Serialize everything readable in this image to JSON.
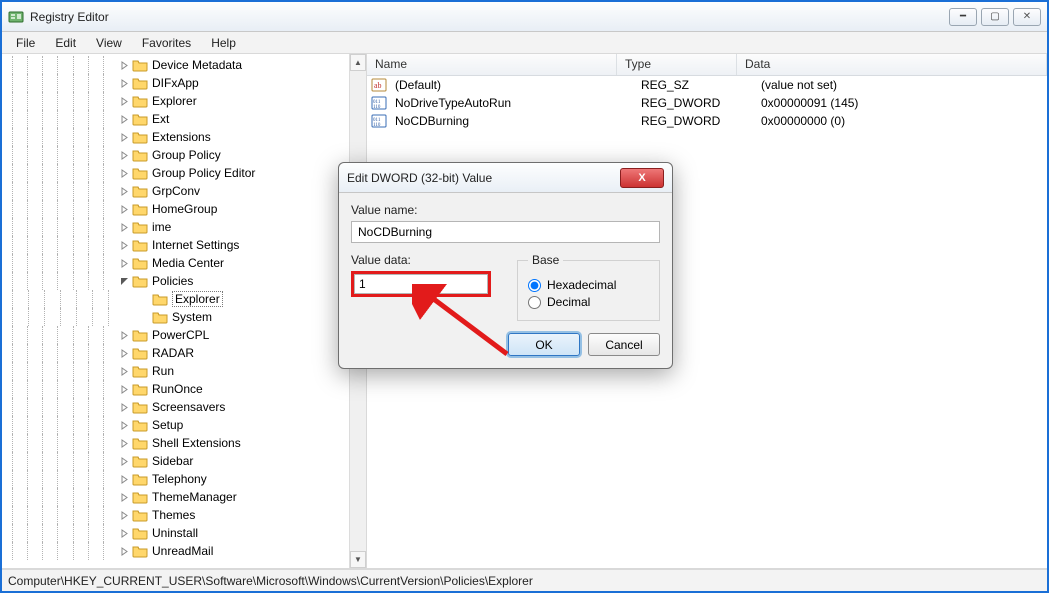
{
  "window": {
    "title": "Registry Editor"
  },
  "menu": {
    "items": [
      "File",
      "Edit",
      "View",
      "Favorites",
      "Help"
    ]
  },
  "tree": {
    "items": [
      {
        "label": "Device Metadata",
        "expandable": true,
        "indent": 0
      },
      {
        "label": "DIFxApp",
        "expandable": true,
        "indent": 0
      },
      {
        "label": "Explorer",
        "expandable": true,
        "indent": 0
      },
      {
        "label": "Ext",
        "expandable": true,
        "indent": 0
      },
      {
        "label": "Extensions",
        "expandable": true,
        "indent": 0
      },
      {
        "label": "Group Policy",
        "expandable": true,
        "indent": 0
      },
      {
        "label": "Group Policy Editor",
        "expandable": true,
        "indent": 0
      },
      {
        "label": "GrpConv",
        "expandable": true,
        "indent": 0
      },
      {
        "label": "HomeGroup",
        "expandable": true,
        "indent": 0
      },
      {
        "label": "ime",
        "expandable": true,
        "indent": 0
      },
      {
        "label": "Internet Settings",
        "expandable": true,
        "indent": 0
      },
      {
        "label": "Media Center",
        "expandable": true,
        "indent": 0
      },
      {
        "label": "Policies",
        "expandable": true,
        "indent": 0,
        "expanded": true
      },
      {
        "label": "Explorer",
        "expandable": false,
        "indent": 1,
        "selected": true
      },
      {
        "label": "System",
        "expandable": false,
        "indent": 1
      },
      {
        "label": "PowerCPL",
        "expandable": true,
        "indent": 0
      },
      {
        "label": "RADAR",
        "expandable": true,
        "indent": 0
      },
      {
        "label": "Run",
        "expandable": true,
        "indent": 0
      },
      {
        "label": "RunOnce",
        "expandable": true,
        "indent": 0
      },
      {
        "label": "Screensavers",
        "expandable": true,
        "indent": 0
      },
      {
        "label": "Setup",
        "expandable": true,
        "indent": 0
      },
      {
        "label": "Shell Extensions",
        "expandable": true,
        "indent": 0
      },
      {
        "label": "Sidebar",
        "expandable": true,
        "indent": 0
      },
      {
        "label": "Telephony",
        "expandable": true,
        "indent": 0
      },
      {
        "label": "ThemeManager",
        "expandable": true,
        "indent": 0
      },
      {
        "label": "Themes",
        "expandable": true,
        "indent": 0
      },
      {
        "label": "Uninstall",
        "expandable": true,
        "indent": 0
      },
      {
        "label": "UnreadMail",
        "expandable": true,
        "indent": 0
      }
    ]
  },
  "list": {
    "columns": {
      "name": "Name",
      "type": "Type",
      "data": "Data"
    },
    "rows": [
      {
        "icon": "string",
        "name": "(Default)",
        "type": "REG_SZ",
        "data": "(value not set)"
      },
      {
        "icon": "dword",
        "name": "NoDriveTypeAutoRun",
        "type": "REG_DWORD",
        "data": "0x00000091 (145)"
      },
      {
        "icon": "dword",
        "name": "NoCDBurning",
        "type": "REG_DWORD",
        "data": "0x00000000 (0)"
      }
    ]
  },
  "status": {
    "path": "Computer\\HKEY_CURRENT_USER\\Software\\Microsoft\\Windows\\CurrentVersion\\Policies\\Explorer"
  },
  "dialog": {
    "title": "Edit DWORD (32-bit) Value",
    "value_name_label": "Value name:",
    "value_name": "NoCDBurning",
    "value_data_label": "Value data:",
    "value_data": "1",
    "base_label": "Base",
    "hex_label": "Hexadecimal",
    "dec_label": "Decimal",
    "ok_label": "OK",
    "cancel_label": "Cancel"
  }
}
